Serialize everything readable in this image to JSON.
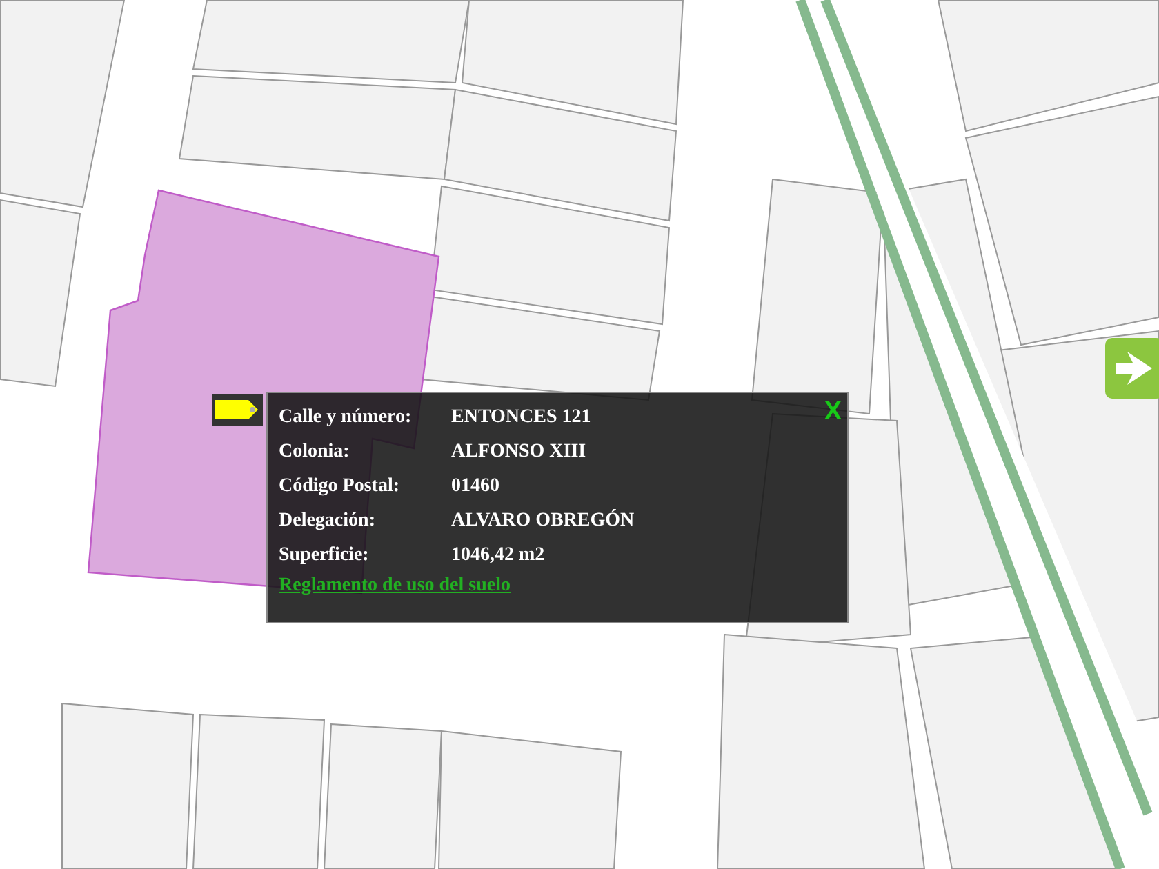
{
  "popup": {
    "close": "X",
    "fields": [
      {
        "label": "Calle y número:",
        "value": "ENTONCES 121"
      },
      {
        "label": "Colonia:",
        "value": "ALFONSO XIII"
      },
      {
        "label": "Código Postal:",
        "value": "01460"
      },
      {
        "label": "Delegación:",
        "value": "ALVARO OBREGÓN"
      },
      {
        "label": "Superficie:",
        "value": "1046,42 m2"
      }
    ],
    "link": "Reglamento de uso del suelo"
  }
}
